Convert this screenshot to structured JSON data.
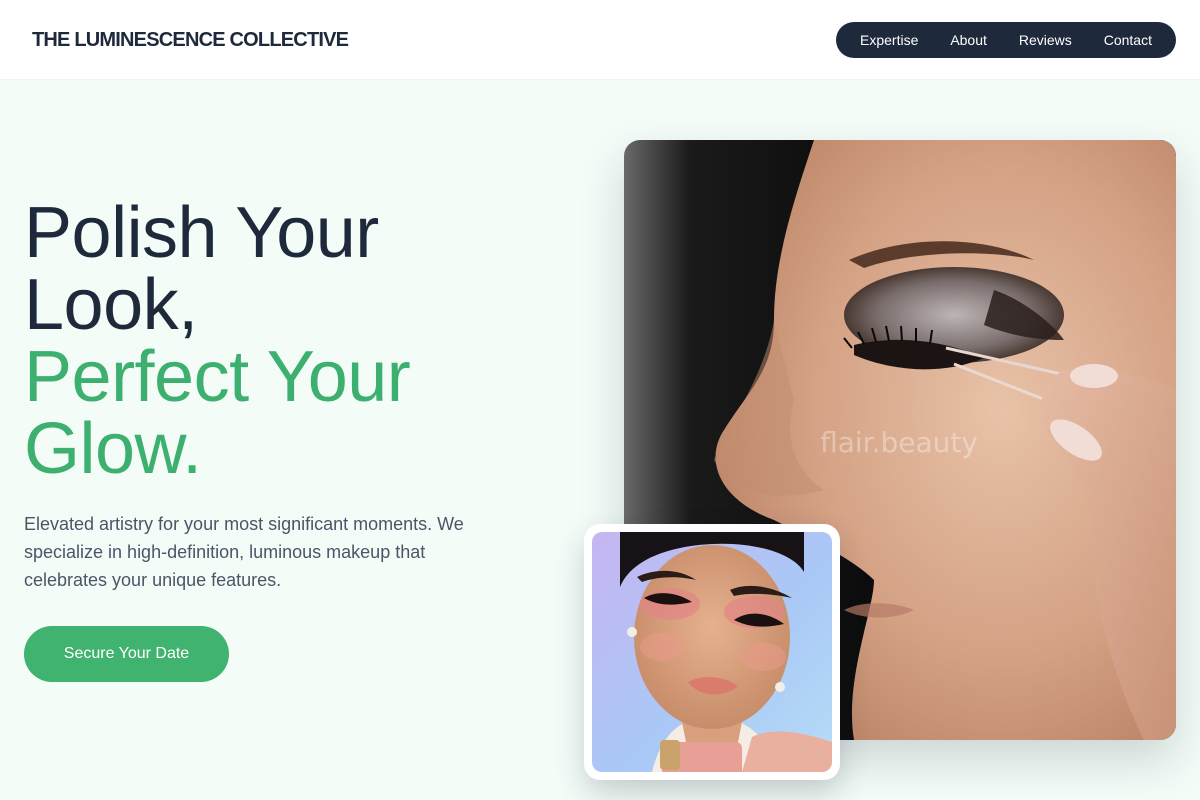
{
  "header": {
    "brand": "THE LUMINESCENCE COLLECTIVE",
    "nav": [
      "Expertise",
      "About",
      "Reviews",
      "Contact"
    ]
  },
  "hero": {
    "title_lines": [
      "Polish Your",
      "Look,"
    ],
    "title_accent_lines": [
      "Perfect Your",
      "Glow."
    ],
    "description": "Elevated artistry for your most significant moments. We specialize in high-definition, luminous makeup that celebrates your unique features.",
    "cta_label": "Secure Your Date"
  },
  "images": {
    "main_watermark": "flair.beauty"
  },
  "colors": {
    "accent": "#3fb36f",
    "dark": "#1e293b",
    "background": "#f3fcf7"
  }
}
